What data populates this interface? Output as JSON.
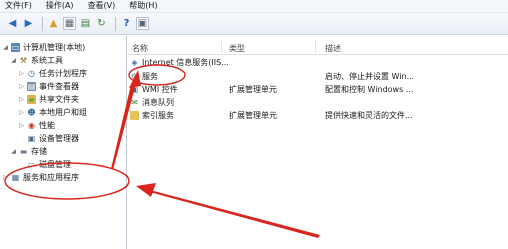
{
  "menu": [
    "文件(F)",
    "操作(A)",
    "查看(V)",
    "帮助(H)"
  ],
  "tree": [
    {
      "label": "计算机管理(本地)",
      "icon": "computer-icon",
      "expander": "◢"
    },
    {
      "label": "系统工具",
      "icon": "tools-icon",
      "expander": "◢"
    },
    {
      "label": "任务计划程序",
      "icon": "clock-icon",
      "expander": "▷"
    },
    {
      "label": "事件查看器",
      "icon": "event-viewer-icon",
      "expander": "▷"
    },
    {
      "label": "共享文件夹",
      "icon": "shared-folder-icon",
      "expander": "▷"
    },
    {
      "label": "本地用户和组",
      "icon": "users-icon",
      "expander": "▷"
    },
    {
      "label": "性能",
      "icon": "performance-icon",
      "expander": "▷"
    },
    {
      "label": "设备管理器",
      "icon": "device-manager-icon",
      "expander": ""
    },
    {
      "label": "存储",
      "icon": "storage-icon",
      "expander": "◢"
    },
    {
      "label": "磁盘管理",
      "icon": "disk-icon",
      "expander": ""
    },
    {
      "label": "服务和应用程序",
      "icon": "services-apps-icon",
      "expander": "▷"
    }
  ],
  "columns": [
    "名称",
    "类型",
    "描述"
  ],
  "rows": [
    {
      "name": "Internet 信息服务(IIS...",
      "type": "",
      "desc": "",
      "icon": "iis-icon"
    },
    {
      "name": "服务",
      "type": "",
      "desc": "启动、停止并设置 Win...",
      "icon": "gear-icon"
    },
    {
      "name": "WMI 控件",
      "type": "扩展管理单元",
      "desc": "配置和控制 Windows ...",
      "icon": "wmi-icon"
    },
    {
      "name": "消息队列",
      "type": "",
      "desc": "",
      "icon": "message-queue-icon"
    },
    {
      "name": "索引服务",
      "type": "扩展管理单元",
      "desc": "提供快速和灵活的文件...",
      "icon": "folder-icon"
    }
  ],
  "colors": {
    "annotation": "#d9261c",
    "selection": "#cfe3fb"
  }
}
